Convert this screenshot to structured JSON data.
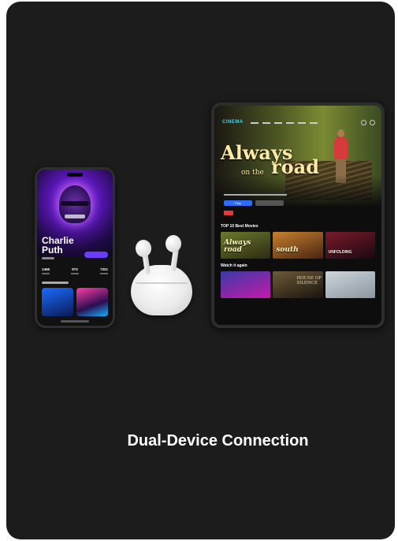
{
  "caption": "Dual-Device Connection",
  "phone": {
    "artist_line1": "Charlie",
    "artist_line2": "Puth",
    "stats": [
      "1456",
      "973",
      "7321"
    ]
  },
  "tablet": {
    "logo": "CINEMA",
    "movie_title_1": "Always",
    "movie_title_2": "on the",
    "movie_title_3": "road",
    "play_label": "Play",
    "row1_title": "TOP 10 Best Movies",
    "row2_title": "Watch it again",
    "row1_tiles": [
      "Always road",
      "south",
      "UNFOLDING"
    ],
    "row2_tiles": [
      "",
      "HOUSE OF SILENCE",
      ""
    ]
  }
}
